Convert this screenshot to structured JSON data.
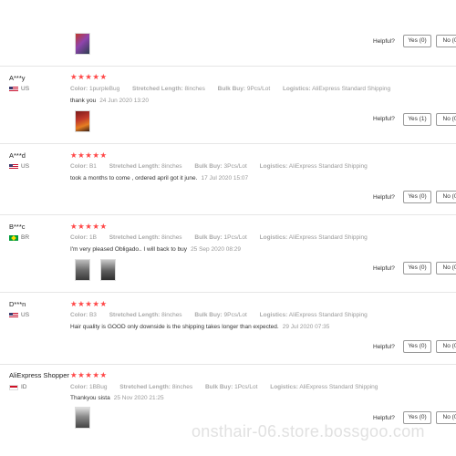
{
  "helpful_label": "Helpful?",
  "reviews": [
    {
      "user": "",
      "country": "",
      "attrs": "",
      "text": "",
      "date": "",
      "yes": "Yes (0)",
      "no": "No (0"
    },
    {
      "user": "A***y",
      "country": "US",
      "color_label": "Color:",
      "color": "1purpleBug",
      "length_label": "Stretched Length:",
      "length": "8inches",
      "bulk_label": "Bulk Buy:",
      "bulk": "9Pcs/Lot",
      "logistics_label": "Logistics:",
      "logistics": "AliExpress Standard Shipping",
      "text": "thank you",
      "date": "24 Jun 2020 13:20",
      "yes": "Yes (1)",
      "no": "No (0"
    },
    {
      "user": "A***d",
      "country": "US",
      "color_label": "Color:",
      "color": "B1",
      "length_label": "Stretched Length:",
      "length": "8inches",
      "bulk_label": "Bulk Buy:",
      "bulk": "3Pcs/Lot",
      "logistics_label": "Logistics:",
      "logistics": "AliExpress Standard Shipping",
      "text": "took a months to come , ordered april got it june.",
      "date": "17 Jul 2020 15:07",
      "yes": "Yes (0)",
      "no": "No (0"
    },
    {
      "user": "B***c",
      "country": "BR",
      "color_label": "Color:",
      "color": "1B",
      "length_label": "Stretched Length:",
      "length": "8inches",
      "bulk_label": "Bulk Buy:",
      "bulk": "1Pcs/Lot",
      "logistics_label": "Logistics:",
      "logistics": "AliExpress Standard Shipping",
      "text": "I'm very pleased Obligado.. I will back to buy",
      "date": "25 Sep 2020 08:29",
      "yes": "Yes (0)",
      "no": "No (0"
    },
    {
      "user": "D***n",
      "country": "US",
      "color_label": "Color:",
      "color": "B3",
      "length_label": "Stretched Length:",
      "length": "8inches",
      "bulk_label": "Bulk Buy:",
      "bulk": "9Pcs/Lot",
      "logistics_label": "Logistics:",
      "logistics": "AliExpress Standard Shipping",
      "text": "Hair quality is GOOD only downside is the shipping takes longer than expected.",
      "date": "29 Jul 2020 07:35",
      "yes": "Yes (0)",
      "no": "No (0"
    },
    {
      "user": "AliExpress Shopper",
      "country": "ID",
      "color_label": "Color:",
      "color": "1BBug",
      "length_label": "Stretched Length:",
      "length": "8inches",
      "bulk_label": "Bulk Buy:",
      "bulk": "1Pcs/Lot",
      "logistics_label": "Logistics:",
      "logistics": "AliExpress Standard Shipping",
      "text": "Thankyou sista",
      "date": "25 Nov 2020 21:25",
      "yes": "Yes (0)",
      "no": "No (0"
    }
  ],
  "stars": "★★★★★",
  "watermark": "onsthair-06.store.bossgoo.com",
  "colors": {
    "star": "#ff4747",
    "divider": "#e6e6e6"
  }
}
